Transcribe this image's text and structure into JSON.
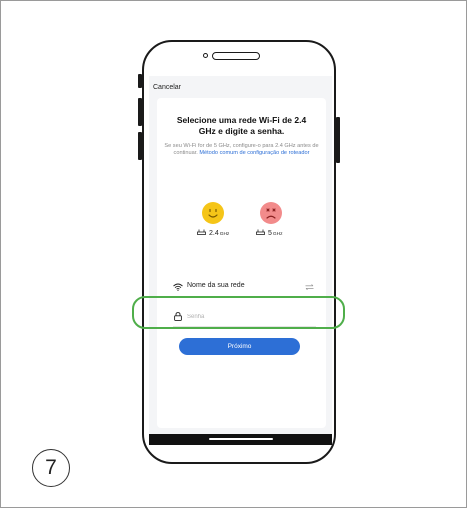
{
  "app": {
    "cancel_label": "Cancelar",
    "title": "Selecione uma rede Wi-Fi de 2.4 GHz e digite a senha.",
    "description_text": "Se seu Wi-Fi for de 5 GHz, configure-o para 2.4 GHz antes de continuar. ",
    "description_link": "Método comum de configuração de roteador",
    "bands": [
      {
        "label": "2.4",
        "unit": "GHz",
        "status": "supported",
        "face_color": "#f5c518"
      },
      {
        "label": "5",
        "unit": "GHz",
        "status": "not-supported",
        "face_color": "#f28b8b"
      }
    ],
    "network_field": {
      "value": "Nome da sua rede",
      "icon": "wifi-icon"
    },
    "switch_icon": "switch-network-icon",
    "password_field": {
      "placeholder": "Senha",
      "value": "",
      "icon": "lock-icon"
    },
    "next_label": "Próximo"
  },
  "step_number": "7",
  "colors": {
    "accent": "#2d6fd6",
    "highlight": "#4fae4a",
    "card_bg": "#ffffff",
    "screen_bg": "#f4f5f7"
  }
}
